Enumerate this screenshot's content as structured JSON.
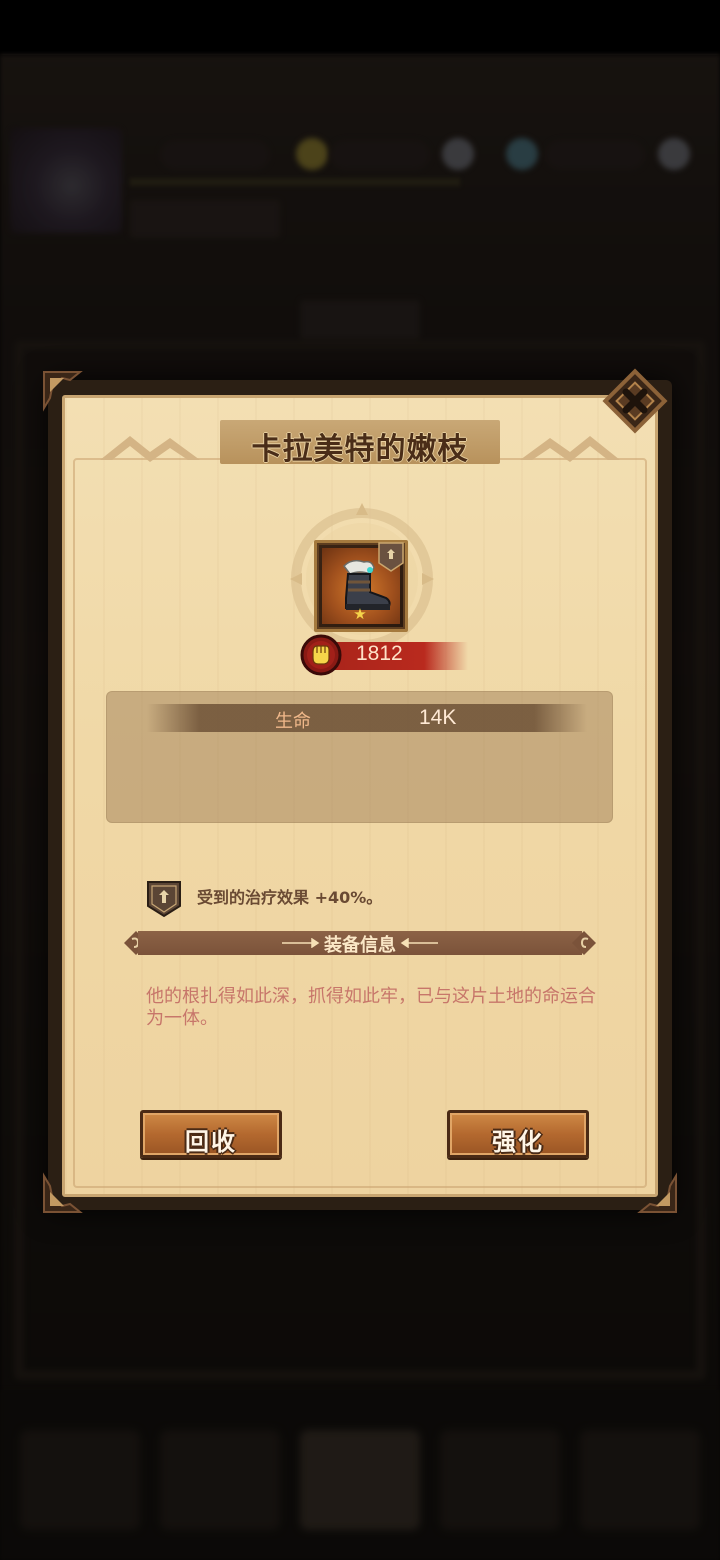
{
  "dialog": {
    "title": "卡拉美特的嫩枝",
    "power": "1812",
    "stats": [
      {
        "label": "生命",
        "value": "14K"
      }
    ],
    "effect_text": "受到的治疗效果 +40%。",
    "section_title": "装备信息",
    "description": "他的根扎得如此深，抓得如此牢，已与这片土地的命运合为一体。",
    "buttons": {
      "recycle": "回收",
      "enhance": "强化"
    },
    "item_stars": 1
  },
  "colors": {
    "panel": "#f0d8a6",
    "title_text": "#4a2d18",
    "power_ribbon": "#b92a1e",
    "description_text": "#c7766a",
    "button": "#b4692f"
  },
  "icons": {
    "close": "close-x-icon",
    "item": "boot-icon",
    "item_type": "shield-badge-icon",
    "power": "fist-icon",
    "effect": "shield-badge-icon"
  }
}
